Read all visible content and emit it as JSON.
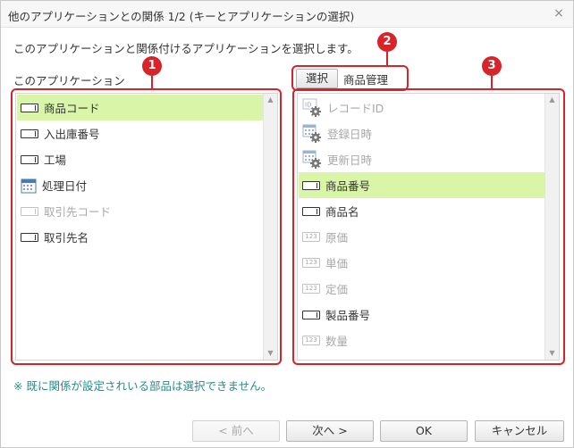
{
  "dialog": {
    "title": "他のアプリケーションとの関係 1/2 (キーとアプリケーションの選択)",
    "close_glyph": "×"
  },
  "instruction": "このアプリケーションと関係付けるアプリケーションを選択します。",
  "left_panel": {
    "label": "このアプリケーション",
    "items": [
      {
        "label": "商品コード",
        "icon": "text-field-icon",
        "state": "selected"
      },
      {
        "label": "入出庫番号",
        "icon": "text-field-icon",
        "state": "normal"
      },
      {
        "label": "工場",
        "icon": "text-field-icon",
        "state": "normal"
      },
      {
        "label": "処理日付",
        "icon": "calendar-icon",
        "state": "normal"
      },
      {
        "label": "取引先コード",
        "icon": "text-field-icon",
        "state": "disabled"
      },
      {
        "label": "取引先名",
        "icon": "text-field-icon",
        "state": "normal"
      }
    ]
  },
  "right_panel": {
    "select_button": "選択",
    "app_name": "商品管理",
    "items": [
      {
        "label": "レコードID",
        "icon": "id-gear-icon",
        "state": "disabled"
      },
      {
        "label": "登録日時",
        "icon": "calendar-gear-icon",
        "state": "disabled"
      },
      {
        "label": "更新日時",
        "icon": "calendar-gear-icon",
        "state": "disabled"
      },
      {
        "label": "商品番号",
        "icon": "text-field-icon",
        "state": "selected"
      },
      {
        "label": "商品名",
        "icon": "text-field-icon",
        "state": "normal"
      },
      {
        "label": "原価",
        "icon": "number-icon",
        "state": "disabled"
      },
      {
        "label": "単価",
        "icon": "number-icon",
        "state": "disabled"
      },
      {
        "label": "定価",
        "icon": "number-icon",
        "state": "disabled"
      },
      {
        "label": "製品番号",
        "icon": "text-field-icon",
        "state": "normal"
      },
      {
        "label": "数量",
        "icon": "number-icon",
        "state": "disabled"
      }
    ]
  },
  "note": "※ 既に関係が設定されいる部品は選択できません。",
  "buttons": {
    "prev": "< 前へ",
    "next": "次へ >",
    "ok": "OK",
    "cancel": "キャンセル"
  },
  "callouts": [
    "1",
    "2",
    "3"
  ],
  "icon_text": {
    "number": "123",
    "id": "ID"
  },
  "colors": {
    "selected_row": "#d8f5a8",
    "callout": "#d9232a",
    "note": "#2a8a8a",
    "disabled_text": "#a8a8a8"
  }
}
